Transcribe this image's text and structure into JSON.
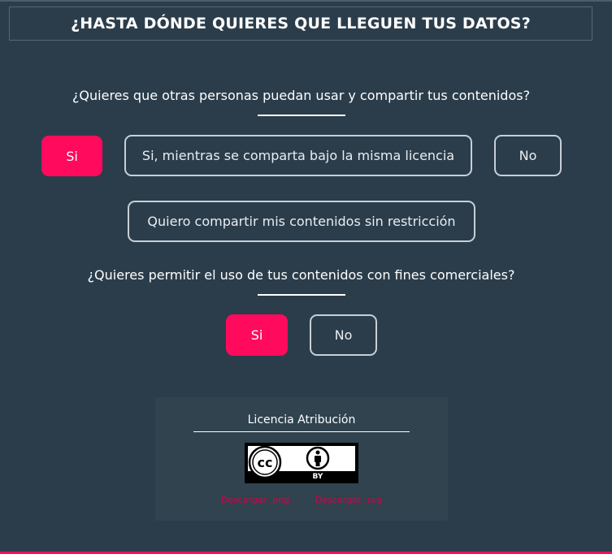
{
  "header": {
    "title": "¿HASTA DÓNDE QUIERES QUE LLEGUEN TUS DATOS?"
  },
  "share": {
    "question": "¿Quieres que otras personas puedan usar y compartir tus contenidos?",
    "options": {
      "yes": "Si",
      "share_alike": "Si, mientras se comparta bajo la misma licencia",
      "no": "No",
      "unrestricted": "Quiero compartir mis contenidos sin restricción"
    },
    "selected": "yes"
  },
  "commercial": {
    "question": "¿Quieres permitir el uso de tus contenidos con fines comerciales?",
    "options": {
      "yes": "Si",
      "no": "No"
    },
    "selected": "yes"
  },
  "license": {
    "title": "Licencia Atribución",
    "badge_by": "BY",
    "badge_cc": "cc",
    "download_png": "Descargar .png",
    "download_svg": "Descargar .svg"
  },
  "colors": {
    "background": "#2b3d4b",
    "accent": "#ff0a5c",
    "outline": "#c7cfd6",
    "download_link": "#c4094b"
  }
}
